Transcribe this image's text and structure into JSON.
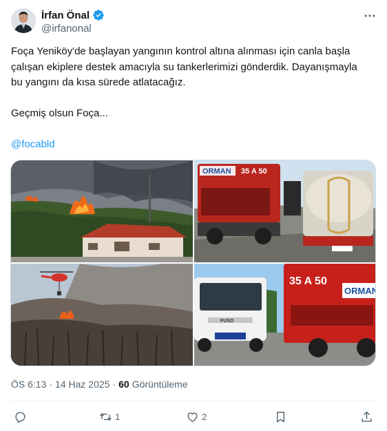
{
  "author": {
    "display_name": "İrfan Önal",
    "handle": "@irfanonal",
    "verified": true
  },
  "tweet": {
    "text": "Foça Yeniköy'de başlayan yangının kontrol altına alınması için canla başla çalışan ekiplere destek amacıyla su tankerlerimizi gönderdik. Dayanışmayla bu yangını da kısa sürede atlatacağız.",
    "closing": "Geçmiş olsun Foça...",
    "mention": "@focabld"
  },
  "media": {
    "truck_plate_top_right": "35 A 50",
    "truck_brand_top_right": "ORMAN",
    "truck_plate_bottom_right": "35 A 50",
    "truck_brand_bottom_right": "ORMAN",
    "pickup_brand": "FUSO"
  },
  "meta": {
    "time": "ÖS 6:13",
    "separator": "·",
    "date": "14 Haz 2025",
    "views_count": "60",
    "views_label": "Görüntüleme"
  },
  "actions": {
    "retweet_count": "1",
    "like_count": "2"
  },
  "colors": {
    "accent": "#1d9bf0",
    "secondary_text": "#536471",
    "primary_text": "#0f1419"
  },
  "icons": [
    "more-icon",
    "verified-icon",
    "reply-icon",
    "retweet-icon",
    "like-icon",
    "bookmark-icon",
    "share-icon"
  ]
}
